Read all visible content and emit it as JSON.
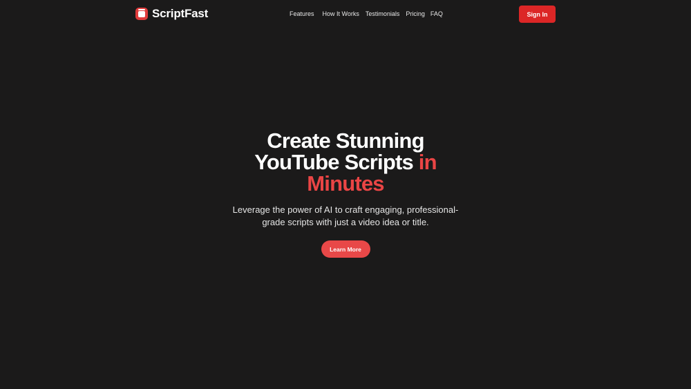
{
  "brand": {
    "name": "ScriptFast",
    "icon": "window-icon",
    "accent_color": "#e03b3b"
  },
  "nav": {
    "items": [
      {
        "label": "Features"
      },
      {
        "label": "How It Works"
      },
      {
        "label": "Testimonials"
      },
      {
        "label": "Pricing"
      },
      {
        "label": "FAQ"
      }
    ]
  },
  "header": {
    "signin_label": "Sign In",
    "signin_color": "#dc2626"
  },
  "hero": {
    "title_main": "Create Stunning YouTube Scripts",
    "title_accent": "in Minutes",
    "accent_color": "#ea4545",
    "subtitle": "Leverage the power of AI to craft engaging, professional-grade scripts with just a video idea or title.",
    "cta_label": "Learn More"
  },
  "theme": {
    "background": "#1b1a1a"
  }
}
